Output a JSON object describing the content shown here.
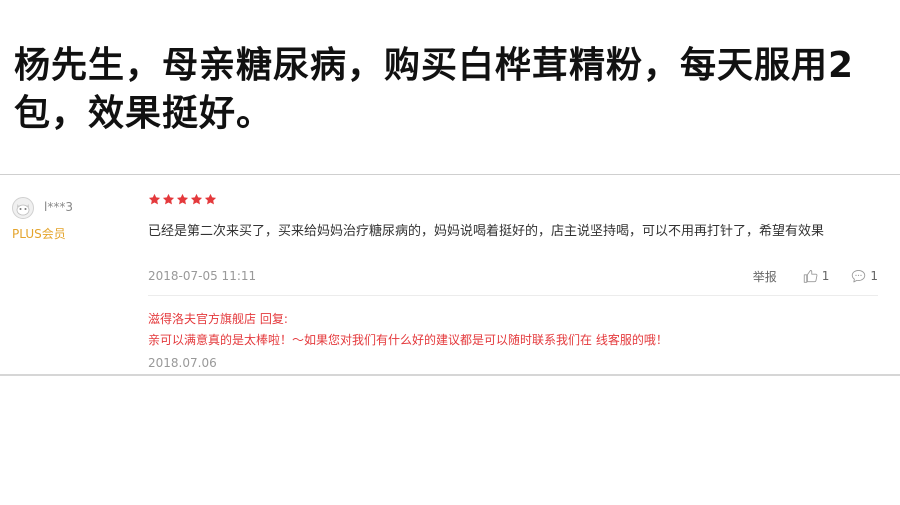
{
  "headline": "杨先生，母亲糖尿病，购买白桦茸精粉，每天服用2包，效果挺好。",
  "review": {
    "user": {
      "name": "l***3",
      "level": "PLUS会员",
      "avatar_icon": "default-avatar-icon"
    },
    "rating": 5,
    "rating_max": 5,
    "star_color": "#e4393c",
    "text": "已经是第二次来买了，买来给妈妈治疗糖尿病的，妈妈说喝着挺好的，店主说坚持喝，可以不用再打针了，希望有效果",
    "date": "2018-07-05 11:11",
    "actions": {
      "report_label": "举报",
      "like_icon": "thumbs-up-icon",
      "like_count": "1",
      "comment_icon": "comment-icon",
      "comment_count": "1"
    },
    "reply": {
      "header": "滋得洛夫官方旗舰店 回复:",
      "text": "亲可以满意真的是太棒啦！～如果您对我们有什么好的建议都是可以随时联系我们在 线客服的哦！",
      "date": "2018.07.06",
      "color": "#e4393c"
    }
  }
}
